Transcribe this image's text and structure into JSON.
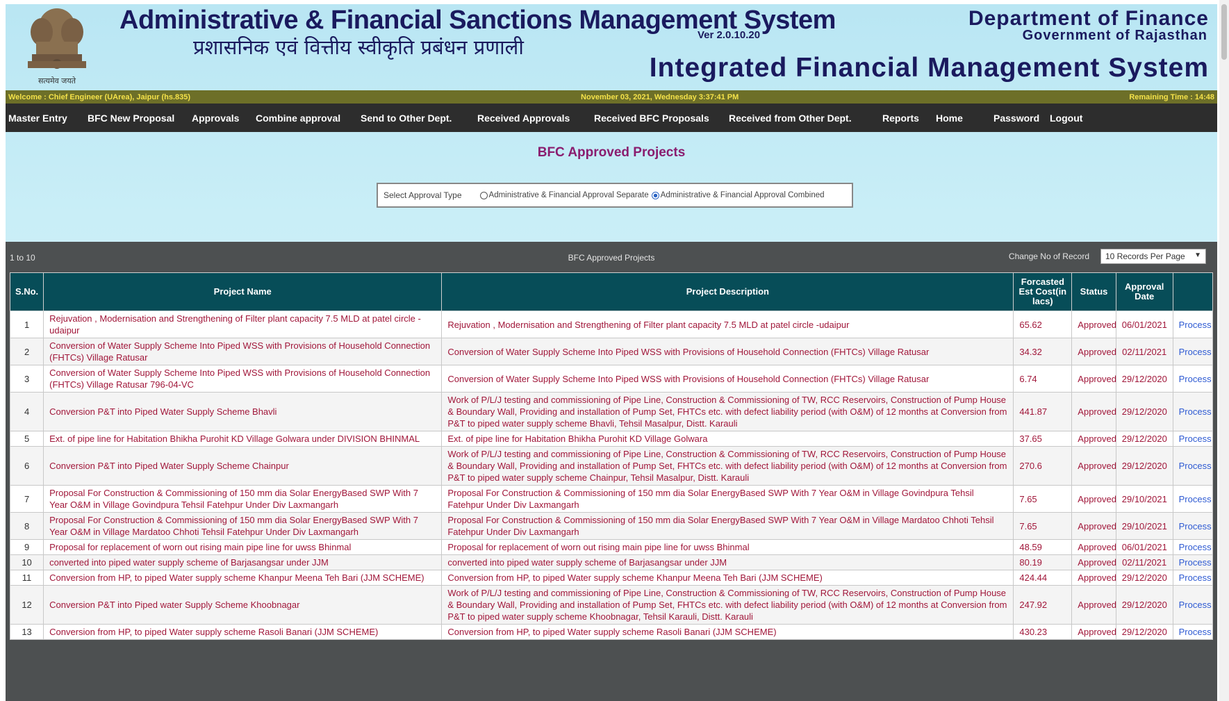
{
  "header": {
    "title_en": "Administrative & Financial Sanctions Management System",
    "version": "Ver 2.0.10.20",
    "title_hi": "प्रशासनिक एवं वित्तीय स्वीकृति प्रबंधन प्रणाली",
    "dept": "Department of Finance",
    "govt": "Government of Rajasthan",
    "ifms": "Integrated Financial Management System",
    "emblem_motto": "सत्यमेव जयते"
  },
  "welcome_bar": {
    "welcome": "Welcome : Chief Engineer (UArea), Jaipur (hs.835)",
    "date": "November 03, 2021, Wednesday 3:37:41 PM",
    "remaining": "Remaining Time : 14:48"
  },
  "nav": {
    "items": [
      "Master Entry",
      "BFC New Proposal",
      "Approvals",
      "Combine approval",
      "Send to Other Dept.",
      "Received Approvals",
      "Received BFC Proposals",
      "Received from Other Dept.",
      "Reports",
      "Home",
      "Password",
      "Logout"
    ]
  },
  "page_title": "BFC Approved Projects",
  "approval_type": {
    "label": "Select Approval Type",
    "options": [
      "Administrative & Financial Approval Separate",
      "Administrative & Financial Approval Combined"
    ],
    "selected_index": 1
  },
  "grid": {
    "range": "1 to 10",
    "title": "BFC Approved Projects",
    "change_label": "Change No of Record",
    "records_per_page": "10 Records Per Page",
    "columns": [
      "S.No.",
      "Project Name",
      "Project Description",
      "Forcasted Est Cost(in lacs)",
      "Status",
      "Approval Date",
      ""
    ],
    "rows": [
      {
        "sno": "1",
        "name": "Rejuvation , Modernisation and Strengthening of Filter plant capacity 7.5 MLD at patel circle -udaipur",
        "desc": "Rejuvation , Modernisation and Strengthening of Filter plant capacity 7.5 MLD at patel circle -udaipur",
        "cost": "65.62",
        "status": "Approved",
        "date": "06/01/2021",
        "action": "Process"
      },
      {
        "sno": "2",
        "name": "Conversion of Water Supply Scheme Into Piped WSS with Provisions of Household Connection (FHTCs) Village Ratusar",
        "desc": "Conversion of Water Supply Scheme Into Piped WSS with Provisions of Household Connection (FHTCs) Village Ratusar",
        "cost": "34.32",
        "status": "Approved",
        "date": "02/11/2021",
        "action": "Process"
      },
      {
        "sno": "3",
        "name": "Conversion of Water Supply Scheme Into Piped WSS with Provisions of Household Connection (FHTCs) Village Ratusar 796-04-VC",
        "desc": "Conversion of Water Supply Scheme Into Piped WSS with Provisions of Household Connection (FHTCs) Village Ratusar",
        "cost": "6.74",
        "status": "Approved",
        "date": "29/12/2020",
        "action": "Process"
      },
      {
        "sno": "4",
        "name": "Conversion P&T into Piped Water Supply Scheme Bhavli",
        "desc": "Work of P/L/J testing and commissioning of Pipe Line, Construction & Commissioning of TW, RCC Reservoirs, Construction of Pump House & Boundary Wall, Providing and installation of Pump Set, FHTCs etc. with defect liability period (with O&M) of 12 months at Conversion from P&T to piped water supply scheme Bhavli, Tehsil Masalpur, Distt. Karauli",
        "cost": "441.87",
        "status": "Approved",
        "date": "29/12/2020",
        "action": "Process"
      },
      {
        "sno": "5",
        "name": "Ext. of pipe line for Habitation Bhikha Purohit KD Village Golwara under DIVISION BHINMAL",
        "desc": "Ext. of pipe line for Habitation Bhikha Purohit KD Village Golwara",
        "cost": "37.65",
        "status": "Approved",
        "date": "29/12/2020",
        "action": "Process"
      },
      {
        "sno": "6",
        "name": "Conversion P&T into Piped Water Supply Scheme Chainpur",
        "desc": "Work of P/L/J testing and commissioning of Pipe Line, Construction & Commissioning of TW, RCC Reservoirs, Construction of Pump House & Boundary Wall, Providing and installation of Pump Set, FHTCs etc. with defect liability period (with O&M) of 12 months at Conversion from P&T to piped water supply scheme Chainpur, Tehsil Masalpur, Distt. Karauli",
        "cost": "270.6",
        "status": "Approved",
        "date": "29/12/2020",
        "action": "Process"
      },
      {
        "sno": "7",
        "name": "Proposal For Construction & Commissioning of 150 mm dia Solar EnergyBased SWP With 7 Year O&M in Village Govindpura Tehsil Fatehpur Under Div Laxmangarh",
        "desc": "Proposal For Construction & Commissioning of 150 mm dia Solar EnergyBased SWP With 7 Year O&M in Village Govindpura Tehsil Fatehpur Under Div Laxmangarh",
        "cost": "7.65",
        "status": "Approved",
        "date": "29/10/2021",
        "action": "Process"
      },
      {
        "sno": "8",
        "name": "Proposal For Construction & Commissioning of 150 mm dia Solar EnergyBased SWP With 7 Year O&M in Village Mardatoo Chhoti Tehsil Fatehpur Under Div Laxmangarh",
        "desc": "Proposal For Construction & Commissioning of 150 mm dia Solar EnergyBased SWP With 7 Year O&M in Village Mardatoo Chhoti Tehsil Fatehpur Under Div Laxmangarh",
        "cost": "7.65",
        "status": "Approved",
        "date": "29/10/2021",
        "action": "Process"
      },
      {
        "sno": "9",
        "name": "Proposal for replacement of worn out rising main pipe line for uwss Bhinmal",
        "desc": "Proposal for replacement of worn out rising main pipe line for uwss Bhinmal",
        "cost": "48.59",
        "status": "Approved",
        "date": "06/01/2021",
        "action": "Process"
      },
      {
        "sno": "10",
        "name": "converted into piped water supply scheme of Barjasangsar under JJM",
        "desc": "converted into piped water supply scheme of Barjasangsar under JJM",
        "cost": "80.19",
        "status": "Approved",
        "date": "02/11/2021",
        "action": "Process"
      },
      {
        "sno": "11",
        "name": "Conversion from HP, to piped Water supply scheme Khanpur Meena Teh Bari (JJM SCHEME)",
        "desc": "Conversion from HP, to piped Water supply scheme Khanpur Meena Teh Bari (JJM SCHEME)",
        "cost": "424.44",
        "status": "Approved",
        "date": "29/12/2020",
        "action": "Process"
      },
      {
        "sno": "12",
        "name": "Conversion P&T into Piped water Supply Scheme Khoobnagar",
        "desc": "Work of P/L/J testing and commissioning of Pipe Line, Construction & Commissioning of TW, RCC Reservoirs, Construction of Pump House & Boundary Wall, Providing and installation of Pump Set, FHTCs etc. with defect liability period (with O&M) of 12 months at Conversion from P&T to piped water supply scheme Khoobnagar, Tehsil Karauli, Distt. Karauli",
        "cost": "247.92",
        "status": "Approved",
        "date": "29/12/2020",
        "action": "Process"
      },
      {
        "sno": "13",
        "name": "Conversion from HP, to piped Water supply scheme Rasoli Banari (JJM SCHEME)",
        "desc": "Conversion from HP, to piped Water supply scheme Rasoli Banari (JJM SCHEME)",
        "cost": "430.23",
        "status": "Approved",
        "date": "29/12/2020",
        "action": "Process"
      }
    ]
  },
  "colors": {
    "header_bg": "#c9eef7",
    "title_text": "#1a1a5e",
    "welcome_bar": "#6d6f28",
    "nav_bg": "#2d2d2d",
    "table_header": "#074d58",
    "cell_text": "#a1173a",
    "link": "#2f5bd3",
    "heading": "#8a1d6f"
  }
}
